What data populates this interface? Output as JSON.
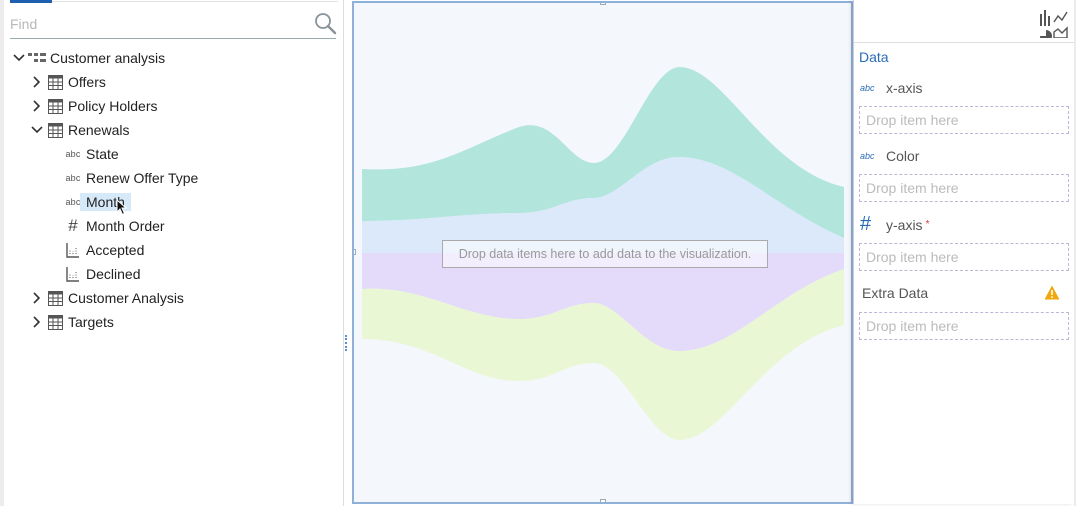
{
  "find": {
    "placeholder": "Find"
  },
  "tree": {
    "root": "Customer analysis",
    "items": [
      {
        "label": "Offers"
      },
      {
        "label": "Policy Holders"
      },
      {
        "label": "Renewals",
        "children": [
          {
            "label": "State",
            "type": "abc"
          },
          {
            "label": "Renew Offer Type",
            "type": "abc"
          },
          {
            "label": "Month",
            "type": "abc"
          },
          {
            "label": "Month Order",
            "type": "#"
          },
          {
            "label": "Accepted",
            "type": "measure"
          },
          {
            "label": "Declined",
            "type": "measure"
          }
        ]
      },
      {
        "label": "Customer Analysis"
      },
      {
        "label": "Targets"
      }
    ]
  },
  "canvas": {
    "drop_message": "Drop data items here to add data to the visualization.",
    "stream_colors": [
      "#b2e5dc",
      "#dce9fa",
      "#e4dafa",
      "#e9f7d4"
    ]
  },
  "data_panel": {
    "title": "Data",
    "abc_tag": "abc",
    "hash_tag": "#",
    "required_mark": "*",
    "slots": {
      "x_axis": {
        "label": "x-axis",
        "placeholder": "Drop item here"
      },
      "color": {
        "label": "Color",
        "placeholder": "Drop item here"
      },
      "y_axis": {
        "label": "y-axis",
        "placeholder": "Drop item here"
      },
      "extra": {
        "label": "Extra Data",
        "placeholder": "Drop item here"
      }
    }
  }
}
